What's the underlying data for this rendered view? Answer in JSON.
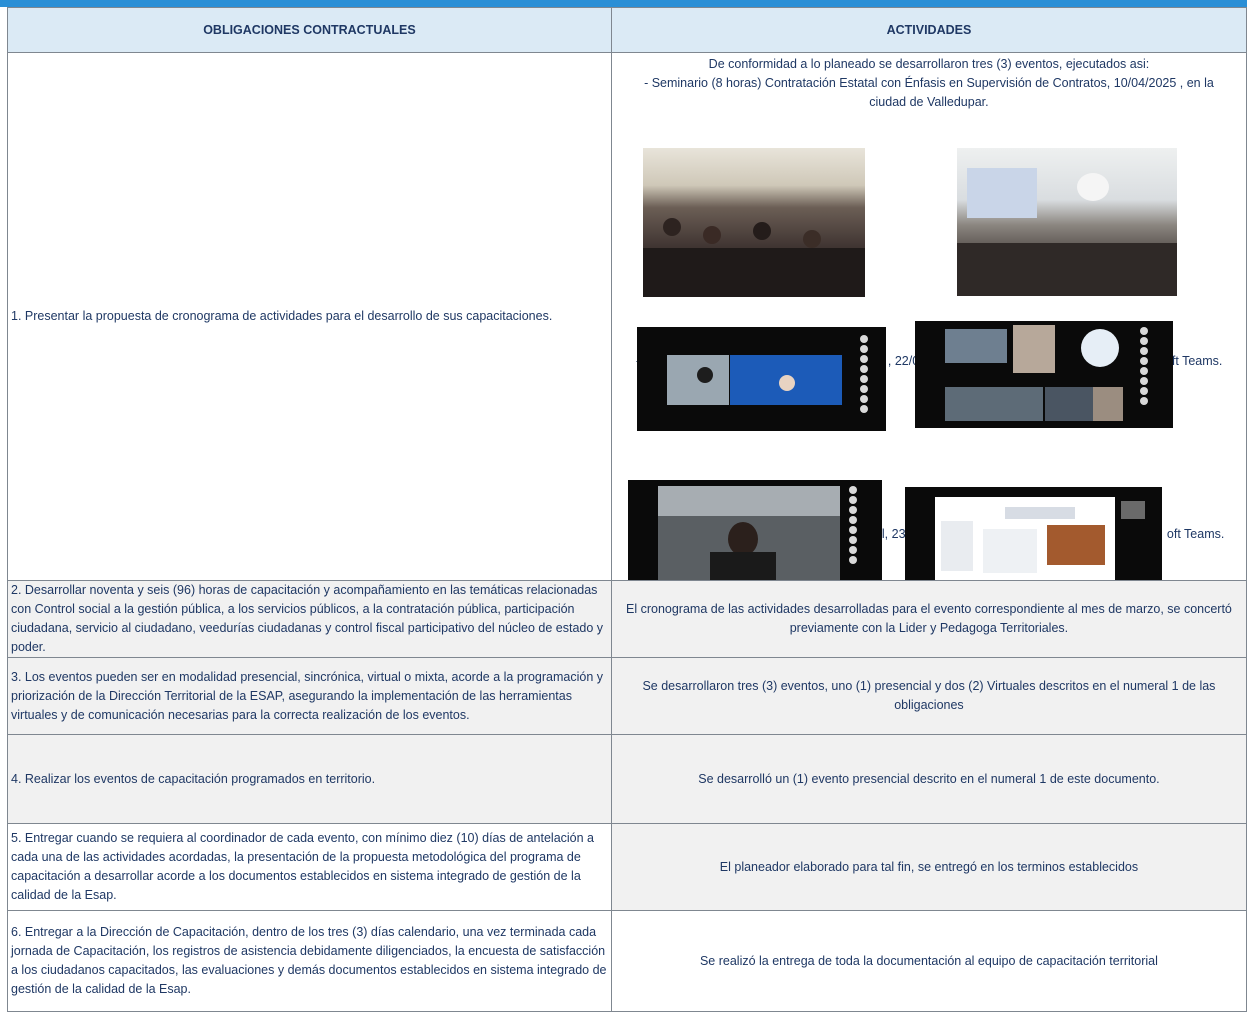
{
  "table": {
    "headers": {
      "col1": "OBLIGACIONES CONTRACTUALES",
      "col2": "ACTIVIDADES"
    },
    "rows": [
      {
        "obligation": "1. Presentar la propuesta de cronograma de actividades para el desarrollo de sus capacitaciones.",
        "activity_intro_1": "De conformidad a lo planeado se desarrollaron tres (3) eventos, ejecutados asi:",
        "activity_intro_2": "- Seminario (8 horas) Contratación Estatal con Énfasis en Supervisión de Contratos, 10/04/2025 , en la",
        "activity_intro_3": "ciudad de Valledupar.",
        "caption_2_left": "-",
        "caption_2_mid": ", 22/0",
        "caption_2_right": "ft Teams.",
        "caption_3_mid": "l, 23",
        "caption_3_right": "oft Teams."
      },
      {
        "obligation": "2. Desarrollar noventa y seis (96) horas de capacitación y acompañamiento en las temáticas relacionadas con Control social a la gestión pública, a los servicios públicos, a la contratación pública, participación ciudadana, servicio al ciudadano, veedurías ciudadanas y control fiscal participativo del núcleo de estado y poder.",
        "activity": "El cronograma de las actividades desarrolladas para el evento correspondiente al mes de marzo, se concertó previamente con la Lider y Pedagoga Territoriales."
      },
      {
        "obligation": "3. Los eventos pueden ser en modalidad presencial, sincrónica, virtual o mixta, acorde a la programación y priorización de la Dirección Territorial de la ESAP, asegurando la implementación de las herramientas virtuales y de comunicación necesarias para la correcta realización de los eventos.",
        "activity": "Se desarrollaron tres (3) eventos, uno (1) presencial y dos (2) Virtuales descritos en el numeral 1 de las obligaciones"
      },
      {
        "obligation": "4. Realizar los eventos de capacitación programados en territorio.",
        "activity": "Se desarrolló un (1) evento presencial descrito en el numeral 1 de este documento."
      },
      {
        "obligation": "5. Entregar cuando se requiera al coordinador de cada evento, con mínimo diez (10) días de antelación a cada una de las actividades acordadas, la presentación de la propuesta metodológica del programa de capacitación a desarrollar acorde a los documentos establecidos en sistema integrado de gestión de la calidad de la Esap.",
        "activity": "El planeador elaborado para tal fin, se entregó en los terminos establecidos"
      },
      {
        "obligation": "6. Entregar a la Dirección de Capacitación, dentro de los tres (3) días calendario, una vez terminada cada jornada de Capacitación, los registros de asistencia debidamente diligenciados, la encuesta de satisfacción a los ciudadanos capacitados, las evaluaciones y demás documentos establecidos en sistema integrado de gestión de la calidad de la Esap.",
        "activity": "Se realizó la entrega de toda la documentación al equipo de capacitación territorial"
      }
    ]
  },
  "colors": {
    "header_bg": "#dbeaf5",
    "top_bar": "#2a8fd6",
    "text": "#1f3864",
    "shaded_row": "#f1f1f1"
  }
}
